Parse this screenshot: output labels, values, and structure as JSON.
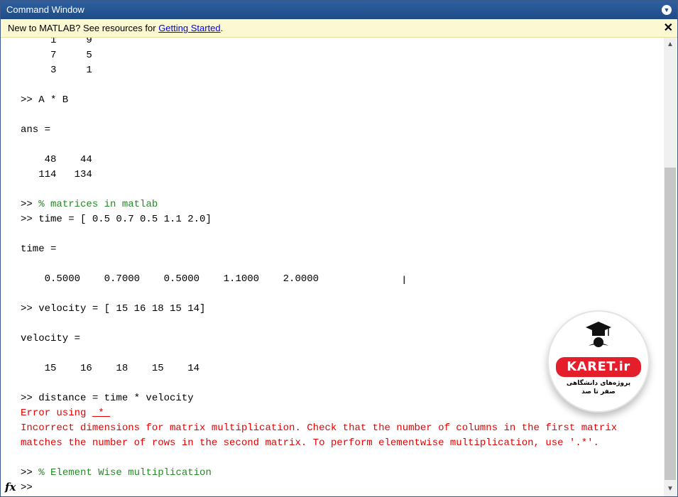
{
  "window": {
    "title": "Command Window"
  },
  "infobar": {
    "text": "New to MATLAB? See resources for ",
    "link": "Getting Started",
    "suffix": ".",
    "close": "✕"
  },
  "console": {
    "lines": [
      {
        "text": "     1     9",
        "kind": "out"
      },
      {
        "text": "     7     5",
        "kind": "out"
      },
      {
        "text": "     3     1",
        "kind": "out"
      },
      {
        "text": "",
        "kind": "out"
      },
      {
        "text": ">> A * B",
        "kind": "cmd"
      },
      {
        "text": "",
        "kind": "out"
      },
      {
        "text": "ans =",
        "kind": "out"
      },
      {
        "text": "",
        "kind": "out"
      },
      {
        "text": "    48    44",
        "kind": "out"
      },
      {
        "text": "   114   134",
        "kind": "out"
      },
      {
        "text": "",
        "kind": "out"
      },
      {
        "prompt": ">> ",
        "text": "% matrices in matlab",
        "kind": "comment"
      },
      {
        "text": ">> time = [ 0.5 0.7 0.5 1.1 2.0]",
        "kind": "cmd"
      },
      {
        "text": "",
        "kind": "out"
      },
      {
        "text": "time =",
        "kind": "out"
      },
      {
        "text": "",
        "kind": "out"
      },
      {
        "text": "    0.5000    0.7000    0.5000    1.1000    2.0000",
        "kind": "out"
      },
      {
        "text": "",
        "kind": "out"
      },
      {
        "text": ">> velocity = [ 15 16 18 15 14]",
        "kind": "cmd"
      },
      {
        "text": "",
        "kind": "out"
      },
      {
        "text": "velocity =",
        "kind": "out"
      },
      {
        "text": "",
        "kind": "out"
      },
      {
        "text": "    15    16    18    15    14",
        "kind": "out"
      },
      {
        "text": "",
        "kind": "out"
      },
      {
        "text": ">> distance = time * velocity",
        "kind": "cmd"
      },
      {
        "prefix": "Error using ",
        "link": " * ",
        "kind": "errlink"
      },
      {
        "text": "Incorrect dimensions for matrix multiplication. Check that the number of columns in the first matrix",
        "kind": "err"
      },
      {
        "text": "matches the number of rows in the second matrix. To perform elementwise multiplication, use '.*'.",
        "kind": "err"
      },
      {
        "text": "",
        "kind": "out"
      },
      {
        "prompt": ">> ",
        "text": "% Element Wise multiplication",
        "kind": "comment"
      },
      {
        "text": ">> ",
        "kind": "cmd"
      }
    ]
  },
  "logo": {
    "brand": "KARET.ir",
    "tagline": "پروژه‌های دانشگاهی\nصفر تا صد"
  },
  "fx_label": "fx"
}
